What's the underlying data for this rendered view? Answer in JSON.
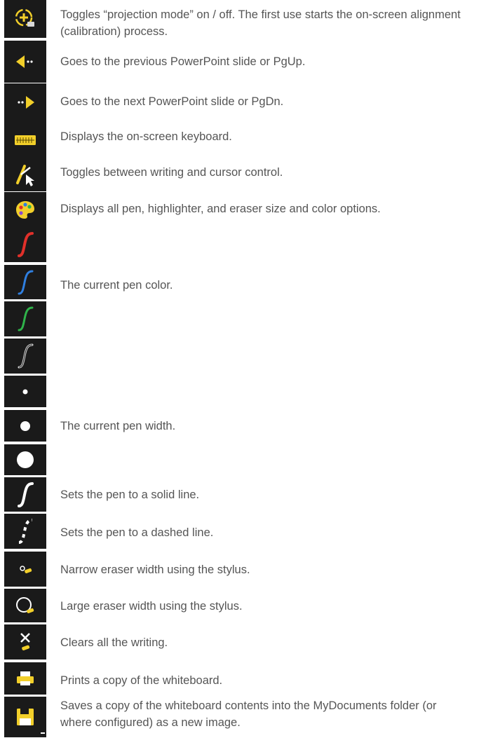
{
  "rows": [
    {
      "icon": "projection-mode-icon",
      "text": "Toggles “projection mode” on / off. The first use starts the on-screen alignment (calibration) process."
    },
    {
      "icon": "previous-slide-icon",
      "text": "Goes to the previous PowerPoint slide or PgUp."
    },
    {
      "icon": "next-slide-icon",
      "text": "Goes to the next PowerPoint slide or PgDn."
    },
    {
      "icon": "keyboard-icon",
      "text": "Displays the on-screen keyboard."
    },
    {
      "icon": "write-cursor-toggle-icon",
      "text": "Toggles between writing and cursor control."
    },
    {
      "icon": "palette-icon",
      "text": "Displays all pen, highlighter, and eraser size and color options."
    },
    {
      "icon": "red-pen-icon"
    },
    {
      "icon": "blue-pen-icon",
      "text": "The current pen color."
    },
    {
      "icon": "green-pen-icon"
    },
    {
      "icon": "white-pen-icon"
    },
    {
      "icon": "small-dot-icon"
    },
    {
      "icon": "medium-dot-icon",
      "text": "The current pen width."
    },
    {
      "icon": "large-dot-icon"
    },
    {
      "icon": "solid-line-icon",
      "text": "Sets the pen to a solid line."
    },
    {
      "icon": "dashed-line-icon",
      "text": "Sets the pen to a dashed line."
    },
    {
      "icon": "narrow-eraser-icon",
      "text": "Narrow eraser width using the stylus."
    },
    {
      "icon": "large-eraser-icon",
      "text": "Large eraser width using the stylus."
    },
    {
      "icon": "clear-all-icon",
      "text": "Clears all the writing."
    },
    {
      "icon": "printer-icon",
      "text": "Prints a copy of the whiteboard."
    },
    {
      "icon": "save-icon",
      "text": "Saves a copy of the whiteboard contents into the MyDocuments folder (or where configured) as a new image."
    }
  ],
  "colors": {
    "red_pen": "#e0302a",
    "blue_pen": "#2f7fe0",
    "green_pen": "#2fb34a",
    "white_pen": "#d8d8d8",
    "accent_yellow": "#f2cf2a"
  }
}
